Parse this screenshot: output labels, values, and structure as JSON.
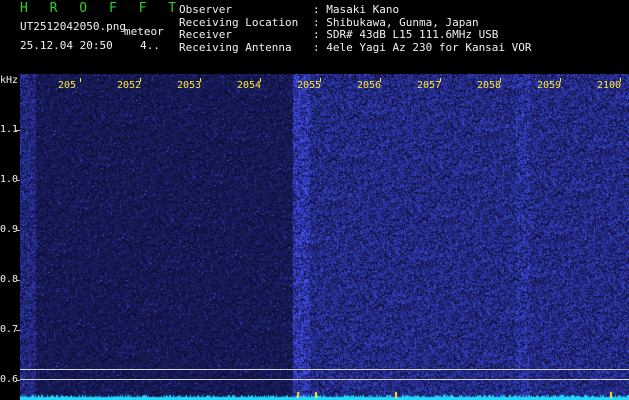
{
  "header": {
    "app_title": "H R O F F T",
    "file_name": "UT2512042050.png",
    "meteor_tag": "meteor",
    "date_time": "25.12.04 20:50",
    "value_tag": "4..",
    "info_labels": [
      "Observer",
      "Receiving Location",
      "Receiver",
      "Receiving Antenna"
    ],
    "info_values": [
      ": Masaki Kano",
      ": Shibukawa, Gunma, Japan",
      ": SDR# 43dB L15 111.6MHz USB",
      ": 4ele Yagi Az 230 for Kansai VOR"
    ]
  },
  "spectrogram": {
    "y_unit": "kHz",
    "y_labels": [
      "1.1",
      "1.0",
      "0.9",
      "0.8",
      "0.7",
      "0.6"
    ],
    "x_labels": [
      "205",
      "2052",
      "2053",
      "2054",
      "2055",
      "2056",
      "2057",
      "2058",
      "2059",
      "2100"
    ],
    "colors": {
      "background": "#000000",
      "noise_dark": "#0d0d5c",
      "noise_bright": "#3a4cff",
      "trace": "#22d8ff",
      "tick": "#ffea3a",
      "title": "#2ad22a"
    }
  }
}
